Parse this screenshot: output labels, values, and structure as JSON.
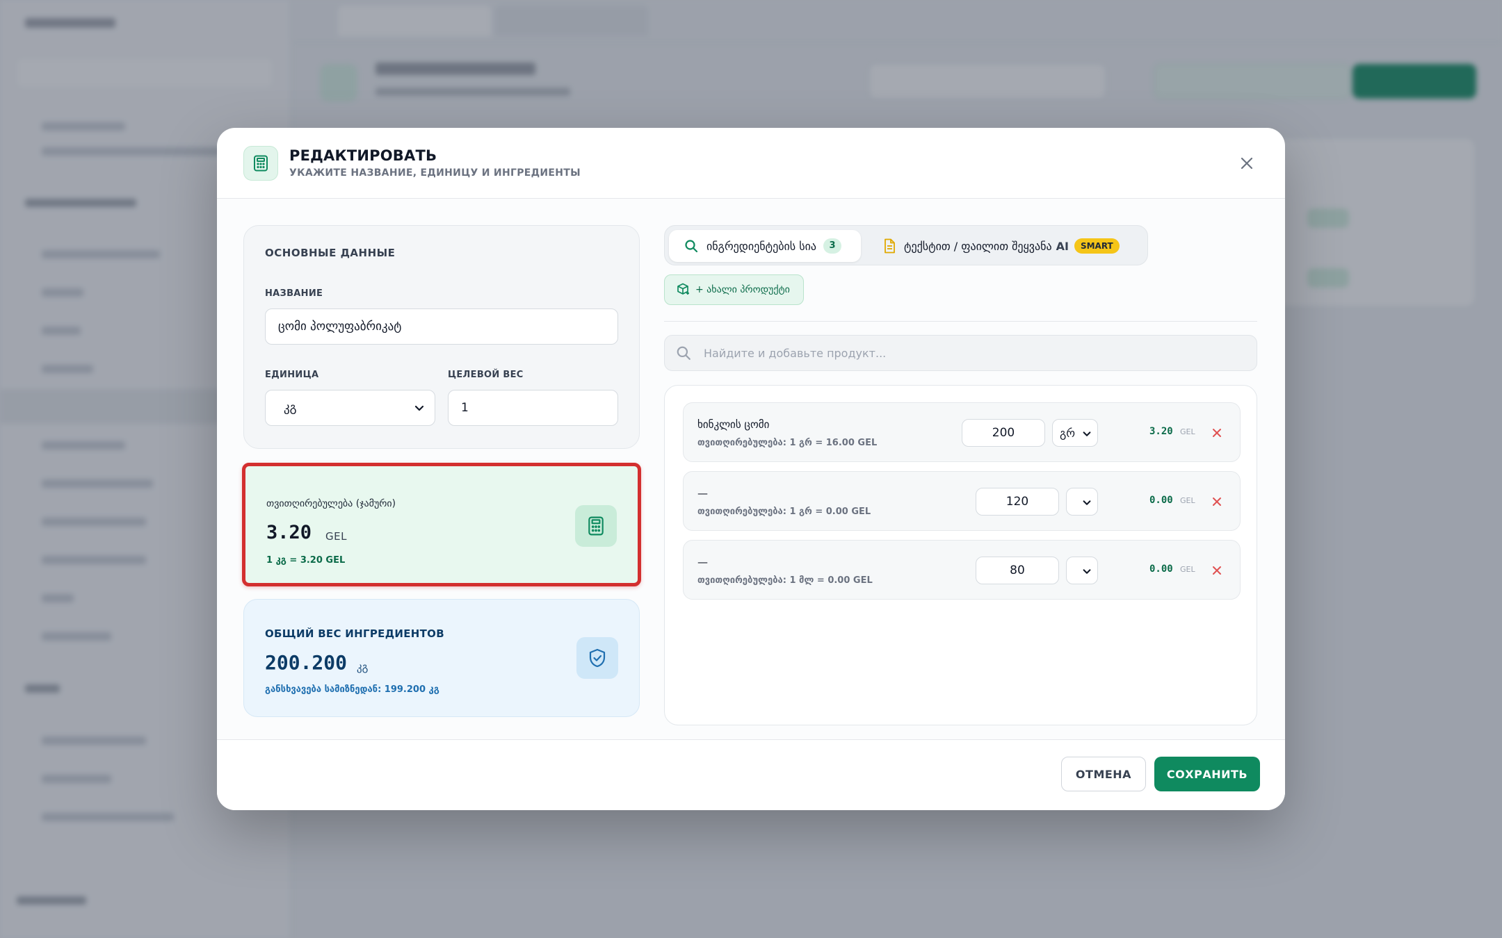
{
  "modal": {
    "title": "РЕДАКТИРОВАТЬ",
    "subtitle": "УКАЖИТЕ НАЗВАНИЕ, ЕДИНИЦУ И ИНГРЕДИЕНТЫ",
    "icons": {
      "header": "calculator-icon",
      "close": "close-icon"
    }
  },
  "basic": {
    "section_title": "ОСНОВНЫЕ ДАННЫЕ",
    "name_label": "НАЗВАНИЕ",
    "name_value": "ცომი პოლუფაბრიკატ",
    "unit_label": "ЕДИНИЦА",
    "unit_value": "კგ",
    "target_weight_label": "ЦЕЛЕВОЙ ВЕС",
    "target_weight_value": "1"
  },
  "cost": {
    "label": "თვითღირებულება (ჯამური)",
    "value": "3.20",
    "currency": "GEL",
    "note": "1 კგ = 3.20 GEL",
    "icon": "calculator-icon",
    "highlight_color": "#d32f2f"
  },
  "weight": {
    "label": "ОБЩИЙ ВЕС ИНГРЕДИЕНТОВ",
    "value": "200.200",
    "unit": "კგ",
    "note": "განსხვავება სამიზნედან: 199.200 კგ",
    "icon": "shield-check-icon"
  },
  "tabs": {
    "ingredients_label": "ინგრედიენტების სია",
    "ingredients_count": "3",
    "import_label": "ტექსტით / ფაილით შეყვანა",
    "import_ai": "AI",
    "import_badge": "SMART"
  },
  "add_product_label": "+ ახალი პროდუქტი",
  "search": {
    "placeholder": "Найдите и добавьте продукт..."
  },
  "ingredients": [
    {
      "name": "ხინკლის ცომი",
      "meta": "თვითღირებულება: 1 გრ = 16.00 GEL",
      "qty": "200",
      "unit": "გრ",
      "price": "3.20",
      "currency": "GEL"
    },
    {
      "name": "—",
      "meta": "თვითღირებულება: 1 გრ = 0.00 GEL",
      "qty": "120",
      "unit": "",
      "price": "0.00",
      "currency": "GEL"
    },
    {
      "name": "—",
      "meta": "თვითღირებულება: 1 მლ = 0.00 GEL",
      "qty": "80",
      "unit": "",
      "price": "0.00",
      "currency": "GEL"
    }
  ],
  "footer": {
    "cancel_label": "ОТМЕНА",
    "save_label": "СОХРАНИТЬ"
  },
  "colors": {
    "accent": "#0f8a5f",
    "danger": "#e05252",
    "smart_badge": "#f5c518"
  }
}
